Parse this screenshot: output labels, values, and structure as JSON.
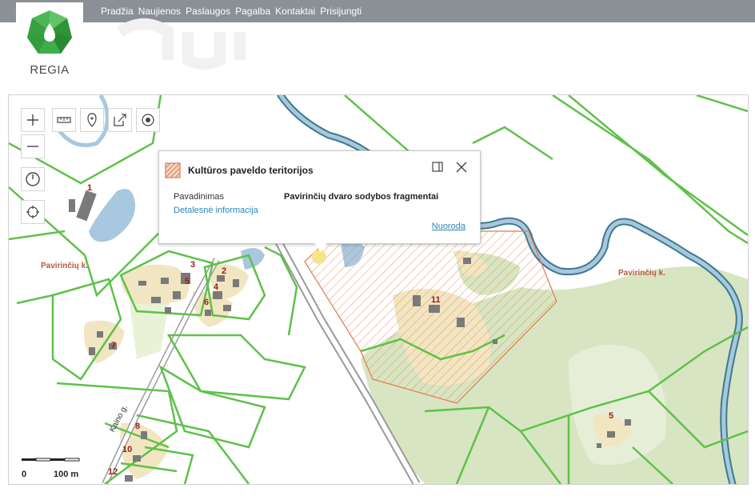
{
  "header": {
    "nav": [
      "Pradžia",
      "Naujienos",
      "Paslaugos",
      "Pagalba",
      "Kontaktai",
      "Prisijungti"
    ],
    "logo_text": "REGIA",
    "brand_color": "#3fae49"
  },
  "map": {
    "village_labels": [
      "Pavirinčių k.",
      "Pavirinčių k."
    ],
    "parcel_numbers": [
      "1",
      "3",
      "2",
      "5",
      "4",
      "6",
      "7",
      "11",
      "8",
      "10",
      "12",
      "5"
    ],
    "road_label": "Kaino g.",
    "scale": {
      "min": "0",
      "max": "100 m"
    },
    "colors": {
      "parcel": "#5ec14a",
      "river": "#3d7a8c",
      "water": "#a8c8e0",
      "forest": "#d8e5c2",
      "heritage": "#e07a4f"
    }
  },
  "popup": {
    "title": "Kultūros paveldo teritorijos",
    "field_label": "Pavadinimas",
    "field_value": "Pavirinčių dvaro sodybos fragmentai",
    "detail_link": "Detalesnė informacija",
    "reference_link": "Nuoroda"
  },
  "tools": {
    "icons": [
      "zoom-in-icon",
      "zoom-out-icon",
      "history-icon",
      "locate-icon",
      "measure-icon",
      "marker-icon",
      "share-icon",
      "target-icon"
    ]
  }
}
